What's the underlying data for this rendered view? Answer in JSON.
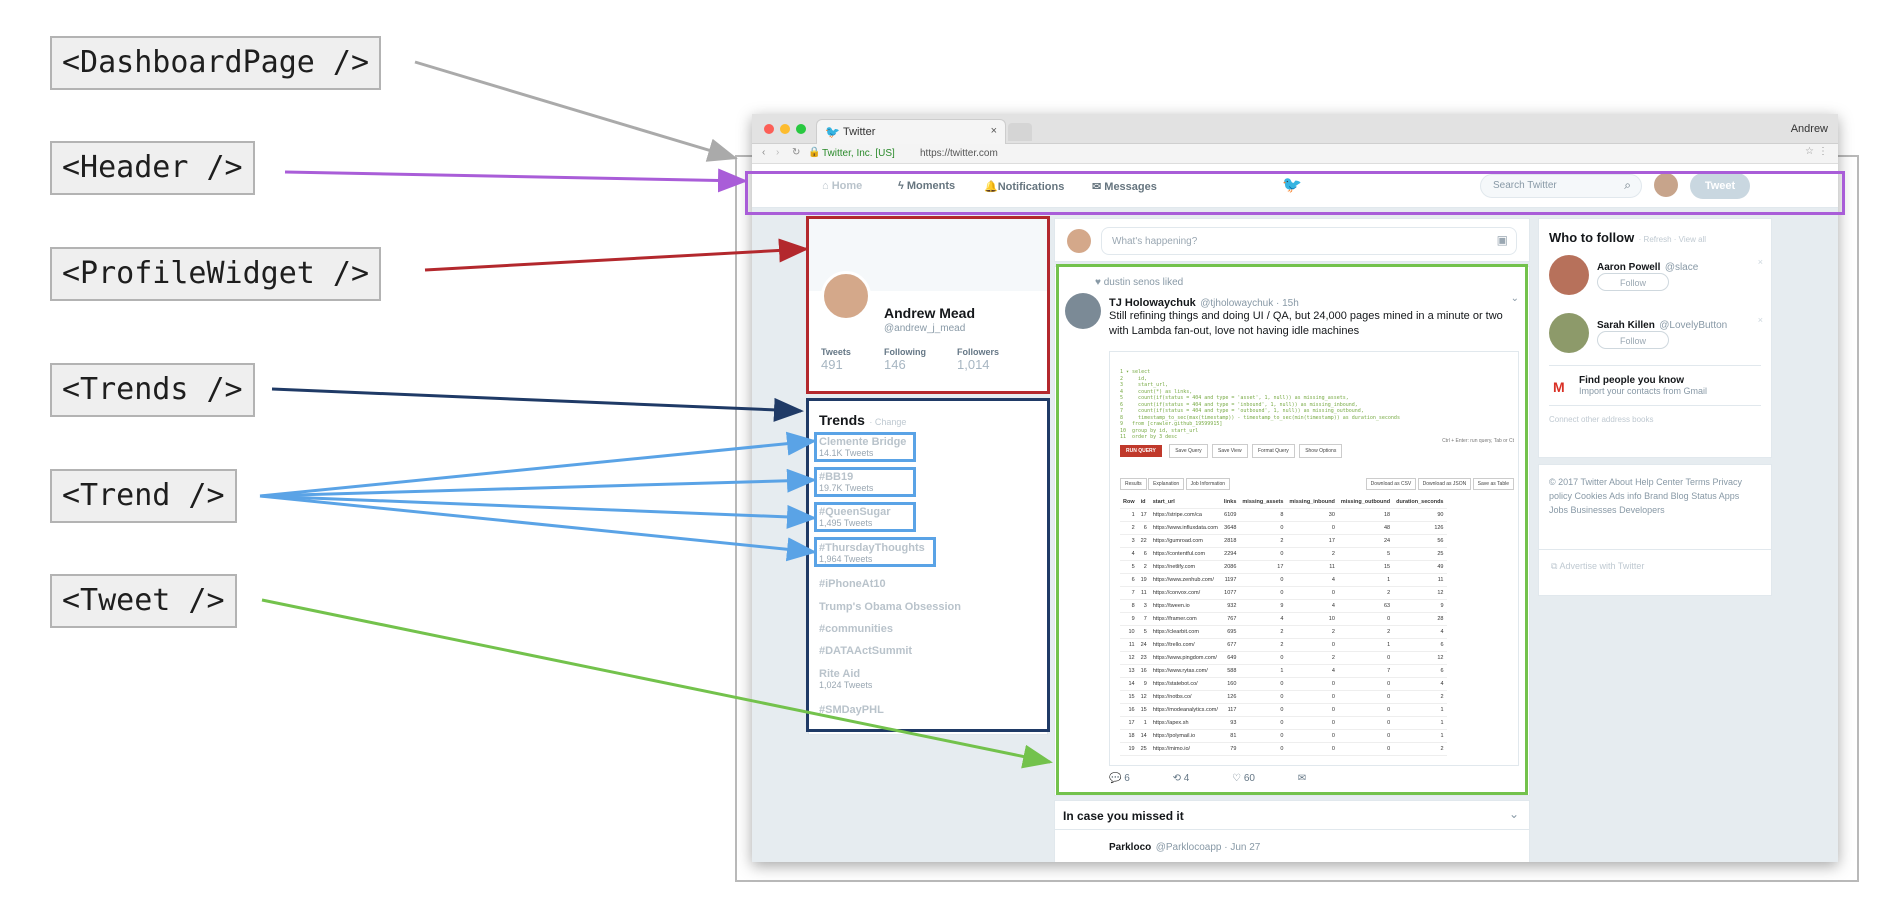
{
  "components": {
    "dashboard": "<DashboardPage />",
    "header": "<Header />",
    "profile": "<ProfileWidget />",
    "trends": "<Trends />",
    "trend": "<Trend />",
    "tweet": "<Tweet />"
  },
  "colors": {
    "dashboard": "#aaaaaa",
    "header": "#a95dd8",
    "profile": "#b3282d",
    "trends": "#1f3a66",
    "trend": "#5aa3e6",
    "tweet": "#73c24c"
  },
  "browser": {
    "tab_title": "Twitter",
    "user": "Andrew",
    "address_site": "Twitter, Inc. [US]",
    "address_url": "https://twitter.com"
  },
  "header": {
    "nav": [
      "Home",
      "Moments",
      "Notifications",
      "Messages"
    ],
    "search_placeholder": "Search Twitter",
    "tweet_button": "Tweet"
  },
  "profile": {
    "name": "Andrew Mead",
    "handle": "@andrew_j_mead",
    "stats": [
      {
        "label": "Tweets",
        "value": "491"
      },
      {
        "label": "Following",
        "value": "146"
      },
      {
        "label": "Followers",
        "value": "1,014"
      }
    ]
  },
  "trends": {
    "title": "Trends",
    "change": "· Change",
    "items": [
      {
        "name": "Clemente Bridge",
        "count": "14.1K Tweets"
      },
      {
        "name": "#BB19",
        "count": "19.7K Tweets"
      },
      {
        "name": "#QueenSugar",
        "count": "1,495 Tweets"
      },
      {
        "name": "#ThursdayThoughts",
        "count": "1,964 Tweets"
      },
      {
        "name": "#iPhoneAt10",
        "count": ""
      },
      {
        "name": "Trump's Obama Obsession",
        "count": ""
      },
      {
        "name": "#communities",
        "count": ""
      },
      {
        "name": "#DATAActSummit",
        "count": ""
      },
      {
        "name": "Rite Aid",
        "count": "1,024 Tweets"
      },
      {
        "name": "#SMDayPHL",
        "count": ""
      }
    ]
  },
  "compose": {
    "placeholder": "What's happening?"
  },
  "tweet": {
    "liked_by": "dustin senos liked",
    "author": "TJ Holowaychuk",
    "handle": "@tjholowaychuk · 15h",
    "text": "Still refining things and doing UI / QA, but 24,000 pages mined in a minute or two with Lambda fan-out, love not having idle machines",
    "actions": {
      "reply": "6",
      "retweet": "4",
      "like": "60"
    },
    "code_lines": [
      "1 ▾ select",
      "2     id,",
      "3     start_url,",
      "4     count(*) as links,",
      "5     count(if(status = 404 and type = 'asset', 1, null)) as missing_assets,",
      "6     count(if(status = 404 and type = 'inbound', 1, null)) as missing_inbound,",
      "7     count(if(status = 404 and type = 'outbound', 1, null)) as missing_outbound,",
      "8     timestamp_to_sec(max(timestamp)) - timestamp_to_sec(min(timestamp)) as duration_seconds",
      "9   from [crawler.github_19599915]",
      "10  group by id, start_url",
      "11  order by 3 desc"
    ],
    "buttons": [
      "RUN QUERY",
      "Save Query",
      "Save View",
      "Format Query",
      "Show Options"
    ],
    "hint": "Ctrl + Enter: run query, Tab or Ct",
    "result_tabs": [
      "Results",
      "Explanation",
      "Job Information"
    ],
    "download_buttons": [
      "Download as CSV",
      "Download as JSON",
      "Save as Table"
    ],
    "columns": [
      "Row",
      "id",
      "start_url",
      "links",
      "missing_assets",
      "missing_inbound",
      "missing_outbound",
      "duration_seconds"
    ],
    "rows": [
      [
        "1",
        "17",
        "https://stripe.com/ca",
        "6109",
        "8",
        "30",
        "18",
        "90"
      ],
      [
        "2",
        "6",
        "https://www.influxdata.com",
        "3648",
        "0",
        "0",
        "48",
        "126"
      ],
      [
        "3",
        "22",
        "https://gumroad.com",
        "2818",
        "2",
        "17",
        "24",
        "56"
      ],
      [
        "4",
        "6",
        "https://contentful.com",
        "2294",
        "0",
        "2",
        "5",
        "25"
      ],
      [
        "5",
        "2",
        "https://netlify.com",
        "2086",
        "17",
        "11",
        "15",
        "49"
      ],
      [
        "6",
        "19",
        "https://www.zenhub.com/",
        "1197",
        "0",
        "4",
        "1",
        "11"
      ],
      [
        "7",
        "11",
        "https://convox.com/",
        "1077",
        "0",
        "0",
        "2",
        "12"
      ],
      [
        "8",
        "3",
        "https://tween.io",
        "932",
        "9",
        "4",
        "63",
        "9"
      ],
      [
        "9",
        "7",
        "https://framer.com",
        "767",
        "4",
        "10",
        "0",
        "28"
      ],
      [
        "10",
        "5",
        "https://clearbit.com",
        "695",
        "2",
        "2",
        "2",
        "4"
      ],
      [
        "11",
        "24",
        "https://trello.com/",
        "677",
        "2",
        "0",
        "1",
        "6"
      ],
      [
        "12",
        "23",
        "https://www.pingdom.com/",
        "649",
        "0",
        "2",
        "0",
        "12"
      ],
      [
        "13",
        "16",
        "https://www.rytas.com/",
        "588",
        "1",
        "4",
        "7",
        "6"
      ],
      [
        "14",
        "9",
        "https://statebot.co/",
        "160",
        "0",
        "0",
        "0",
        "4"
      ],
      [
        "15",
        "12",
        "https://notbs.co/",
        "126",
        "0",
        "0",
        "0",
        "2"
      ],
      [
        "16",
        "15",
        "https://modeanalytics.com/",
        "117",
        "0",
        "0",
        "0",
        "1"
      ],
      [
        "17",
        "1",
        "https://apex.sh",
        "93",
        "0",
        "0",
        "0",
        "1"
      ],
      [
        "18",
        "14",
        "https://polymail.io",
        "81",
        "0",
        "0",
        "0",
        "1"
      ],
      [
        "19",
        "25",
        "https://mimo.io/",
        "79",
        "0",
        "0",
        "0",
        "2"
      ]
    ]
  },
  "missed": {
    "title": "In case you missed it",
    "author": "Parkloco",
    "handle": "@Parklocoapp · Jun 27"
  },
  "who_to_follow": {
    "title": "Who to follow",
    "links": "· Refresh · View all",
    "people": [
      {
        "name": "Aaron Powell",
        "handle": "@slace",
        "button": "Follow"
      },
      {
        "name": "Sarah Killen",
        "handle": "@LovelyButton",
        "button": "Follow"
      }
    ],
    "find_title": "Find people you know",
    "find_sub": "Import your contacts from Gmail",
    "connect": "Connect other address books"
  },
  "footer": {
    "links": [
      "© 2017 Twitter",
      "About",
      "Help Center",
      "Terms",
      "Privacy policy",
      "Cookies",
      "Ads info",
      "Brand",
      "Blog",
      "Status",
      "Apps",
      "Jobs",
      "Businesses",
      "Developers"
    ],
    "advertise": "Advertise with Twitter"
  }
}
